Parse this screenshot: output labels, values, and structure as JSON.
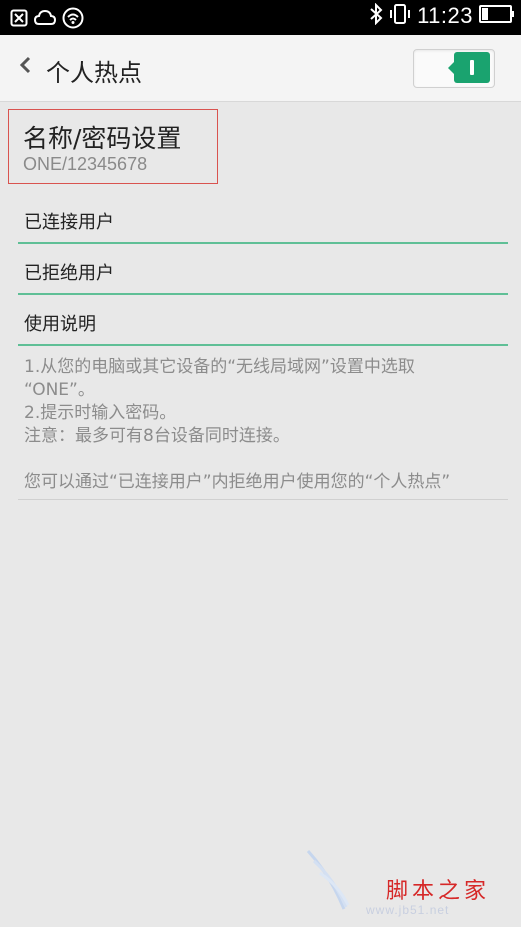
{
  "status_bar": {
    "time": "11:23",
    "left_icons": [
      "close-box-icon",
      "cloud-icon",
      "hotspot-icon"
    ],
    "right_icons": [
      "bluetooth-icon",
      "vibrate-icon",
      "battery-icon"
    ]
  },
  "header": {
    "back_icon": "chevron-left-icon",
    "title": "个人热点",
    "toggle_on": true
  },
  "name_password": {
    "title": "名称/密码设置",
    "value": "ONE/12345678"
  },
  "rows": [
    {
      "label": "已连接用户"
    },
    {
      "label": "已拒绝用户"
    },
    {
      "label": "使用说明"
    }
  ],
  "help": {
    "line1": "1.从您的电脑或其它设备的“无线局域网”设置中选取",
    "line2": "“ONE”。",
    "line3": "2.提示时输入密码。",
    "line4": "注意：最多可有8台设备同时连接。",
    "line5": "您可以通过“已连接用户”内拒绝用户使用您的“个人热点”"
  },
  "watermark": {
    "text": "脚本之家",
    "url": "www.jb51.net"
  },
  "colors": {
    "accent": "#1aa36f",
    "divider": "#5fbf96",
    "highlight_box": "#d9534f",
    "background": "#e8e8e8"
  }
}
